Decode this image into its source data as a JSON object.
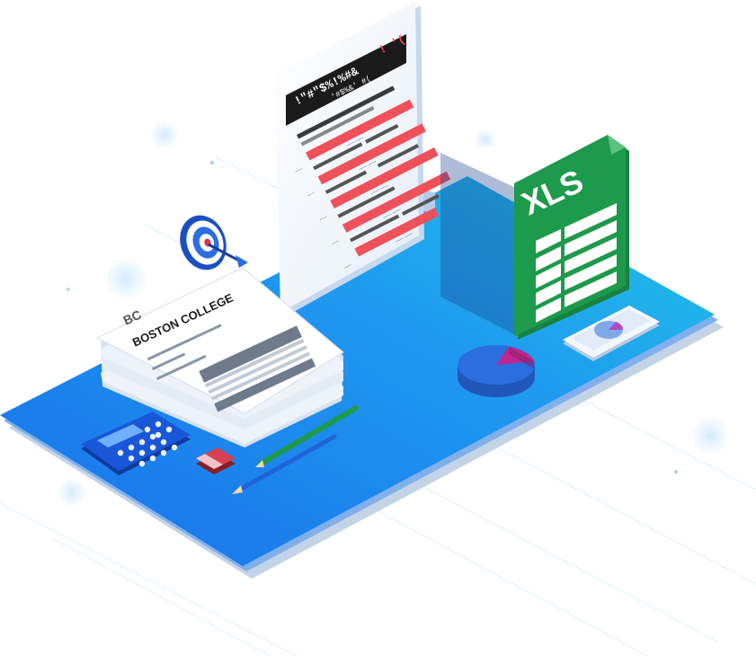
{
  "report": {
    "header_line1": "!\"#\"$%!%#&",
    "header_line1_right": "! '(",
    "header_line2": "'#$%&' #(",
    "rows": [
      {
        "label": "-----",
        "value": "------ ------"
      },
      {
        "label": "-----",
        "value": "------ ------"
      },
      {
        "label": "-----",
        "value": "------ ------"
      },
      {
        "label": "-----",
        "value": "------ ------"
      },
      {
        "label": "-----",
        "value": "------ ------"
      }
    ]
  },
  "xls_badge": "XLS",
  "college_doc": {
    "logo": "BC",
    "title": "BOSTON COLLEGE"
  },
  "colors": {
    "platform": "#1f8df0",
    "platform_edge": "#a9c8ef",
    "xls_green": "#1d9a4c",
    "report_red": "#f0505a",
    "report_header": "#1a1a1a",
    "pie_blue": "#2a6ee0",
    "pie_magenta": "#c0288e"
  },
  "icons": [
    "target-icon",
    "dart-icon",
    "calculator-icon",
    "pencil-icon",
    "eraser-icon",
    "pie-chart-icon",
    "phone-icon"
  ]
}
